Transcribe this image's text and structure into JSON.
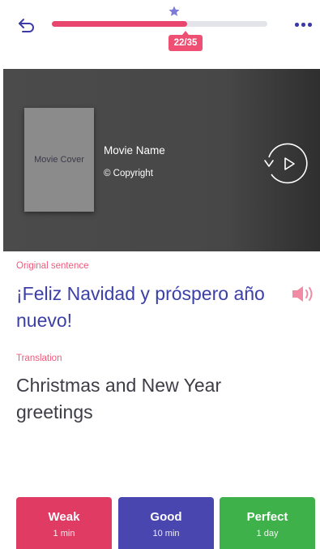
{
  "header": {
    "progress": {
      "current": 22,
      "total": 35,
      "label": "22/35",
      "fraction": 0.629
    },
    "colors": {
      "fill": "#e8466e",
      "track": "#e3e3ea",
      "star": "#7d7ad8",
      "icons": "#3b3aa6"
    }
  },
  "movie": {
    "cover_text": "Movie Cover",
    "name": "Movie Name",
    "copyright": "© Copyright"
  },
  "sentence": {
    "original_label": "Original sentence",
    "original_text": "¡Feliz Navidad y próspero año nuevo!",
    "translation_label": "Translation",
    "translation_text": "Christmas and New Year greetings"
  },
  "rating": {
    "weak": {
      "title": "Weak",
      "interval": "1 min",
      "color": "#e03b62"
    },
    "good": {
      "title": "Good",
      "interval": "10 min",
      "color": "#4a46b0"
    },
    "perfect": {
      "title": "Perfect",
      "interval": "1 day",
      "color": "#3fb14a"
    }
  }
}
